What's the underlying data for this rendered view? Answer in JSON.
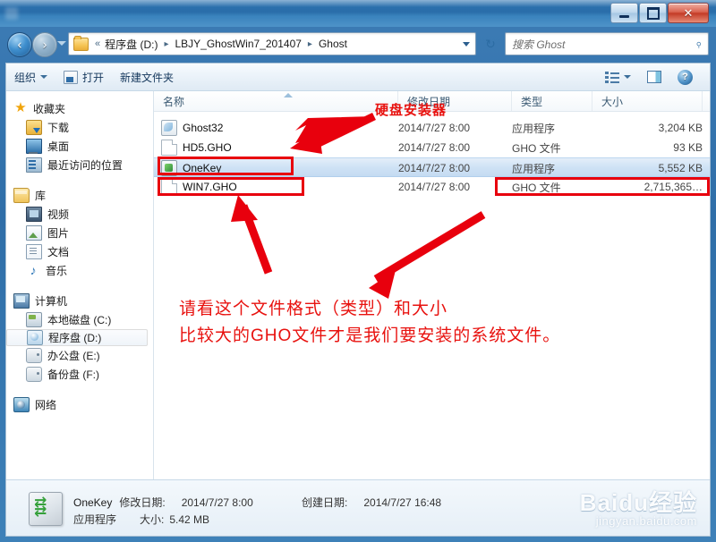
{
  "window": {
    "title": "",
    "minimize_label": "最小化",
    "maximize_label": "最大化",
    "close_label": "✕"
  },
  "address": {
    "back_label": "‹",
    "forward_label": "›",
    "chevron": "«",
    "crumbs": [
      "程序盘 (D:)",
      "LBJY_GhostWin7_201407",
      "Ghost"
    ],
    "separator": "▸",
    "refresh_icon": "↻"
  },
  "search": {
    "placeholder": "搜索 Ghost",
    "icon": "search-icon",
    "glyph": "⌕"
  },
  "toolbar": {
    "organize": "组织",
    "open": "打开",
    "new_folder": "新建文件夹",
    "view_icon": "view-list-icon",
    "preview_icon": "preview-pane-icon",
    "help_icon": "?"
  },
  "navpane": {
    "groups": [
      {
        "name": "收藏夹",
        "icon": "star-icon",
        "items": [
          {
            "label": "下载",
            "icon": "downloads-icon"
          },
          {
            "label": "桌面",
            "icon": "desktop-icon"
          },
          {
            "label": "最近访问的位置",
            "icon": "recent-places-icon"
          }
        ]
      },
      {
        "name": "库",
        "icon": "library-icon",
        "items": [
          {
            "label": "视频",
            "icon": "videos-icon"
          },
          {
            "label": "图片",
            "icon": "pictures-icon"
          },
          {
            "label": "文档",
            "icon": "documents-icon"
          },
          {
            "label": "音乐",
            "icon": "music-icon"
          }
        ]
      },
      {
        "name": "计算机",
        "icon": "computer-icon",
        "items": [
          {
            "label": "本地磁盘 (C:)",
            "icon": "local-disk-icon",
            "selected": false
          },
          {
            "label": "程序盘 (D:)",
            "icon": "program-disk-icon",
            "selected": true
          },
          {
            "label": "办公盘 (E:)",
            "icon": "drive-icon",
            "selected": false
          },
          {
            "label": "备份盘 (F:)",
            "icon": "drive-icon",
            "selected": false
          }
        ]
      },
      {
        "name": "网络",
        "icon": "network-icon",
        "items": []
      }
    ]
  },
  "filelist": {
    "columns": [
      {
        "label": "名称",
        "key": "name"
      },
      {
        "label": "修改日期",
        "key": "date"
      },
      {
        "label": "类型",
        "key": "type"
      },
      {
        "label": "大小",
        "key": "size"
      }
    ],
    "sort_column": "名称",
    "rows": [
      {
        "name": "Ghost32",
        "date": "2014/7/27 8:00",
        "type": "应用程序",
        "size": "3,204 KB",
        "icon": "ghost32-app-icon",
        "selected": false
      },
      {
        "name": "HD5.GHO",
        "date": "2014/7/27 8:00",
        "type": "GHO 文件",
        "size": "93 KB",
        "icon": "gho-file-icon",
        "selected": false
      },
      {
        "name": "OneKey",
        "date": "2014/7/27 8:00",
        "type": "应用程序",
        "size": "5,552 KB",
        "icon": "onekey-app-icon",
        "selected": true
      },
      {
        "name": "WIN7.GHO",
        "date": "2014/7/27 8:00",
        "type": "GHO 文件",
        "size": "2,715,365…",
        "icon": "gho-file-icon",
        "selected": false
      }
    ]
  },
  "details": {
    "name": "OneKey",
    "modified_label": "修改日期:",
    "modified_value": "2014/7/27 8:00",
    "created_label": "创建日期:",
    "created_value": "2014/7/27 16:48",
    "type": "应用程序",
    "size_label": "大小:",
    "size_value": "5.42 MB"
  },
  "annotations": {
    "hdd_installer": "硬盘安装器",
    "line1": "请看这个文件格式（类型）和大小",
    "line2": "比较大的GHO文件才是我们要安装的系统文件。",
    "accent_color": "#e8000d",
    "text_color": "#e8120f"
  },
  "watermark": {
    "brand": "Baidu经验",
    "url": "jingyan.baidu.com"
  }
}
